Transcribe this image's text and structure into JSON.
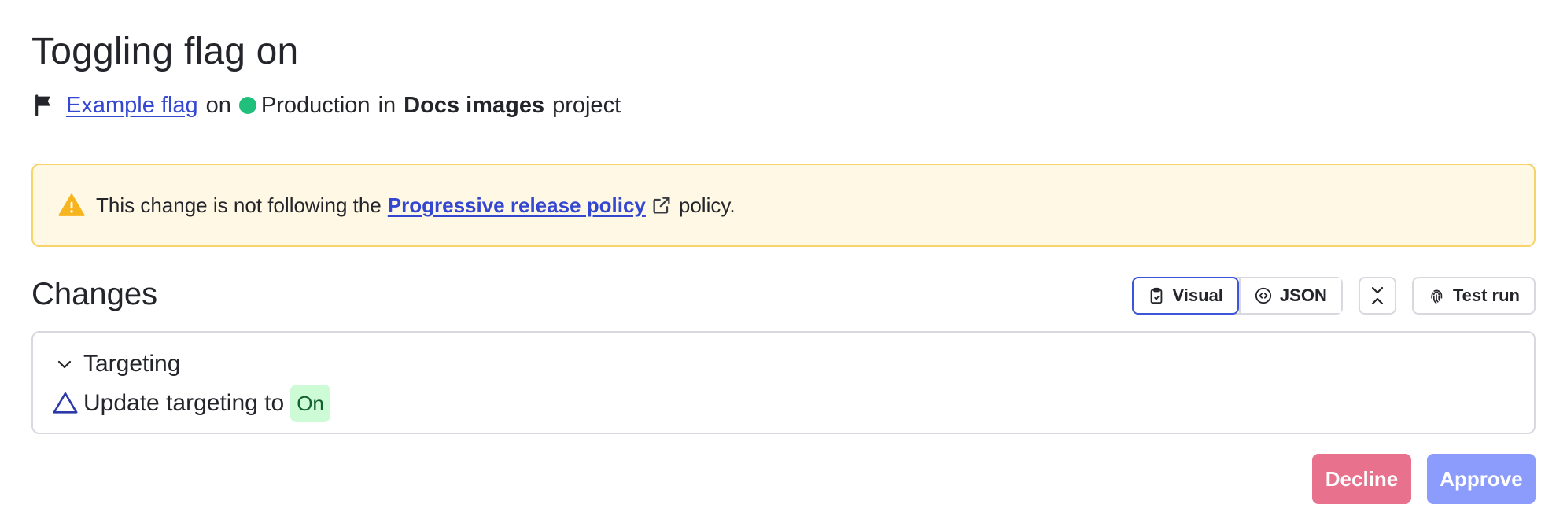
{
  "header": {
    "title": "Toggling flag on",
    "flag_name": "Example flag",
    "word_on": "on",
    "environment": "Production",
    "word_in": "in",
    "project": "Docs images",
    "word_project": "project",
    "env_color": "#20c07c"
  },
  "alert": {
    "prefix": "This change is not following the",
    "policy_link": "Progressive release policy",
    "suffix": "policy.",
    "icon": "warning-icon"
  },
  "changes": {
    "title": "Changes",
    "toolbar": {
      "visual_label": "Visual",
      "json_label": "JSON",
      "collapse_icon": "collapse-icon",
      "test_run_label": "Test run"
    },
    "section": {
      "title": "Targeting",
      "line_text": "Update targeting to",
      "value": "On"
    }
  },
  "actions": {
    "decline": "Decline",
    "approve": "Approve"
  },
  "colors": {
    "link": "#3447d0",
    "decline": "#e8728e",
    "approve": "#8b9cfc",
    "alert_bg": "#fef8e4",
    "pill_bg": "#ccfbd5"
  }
}
